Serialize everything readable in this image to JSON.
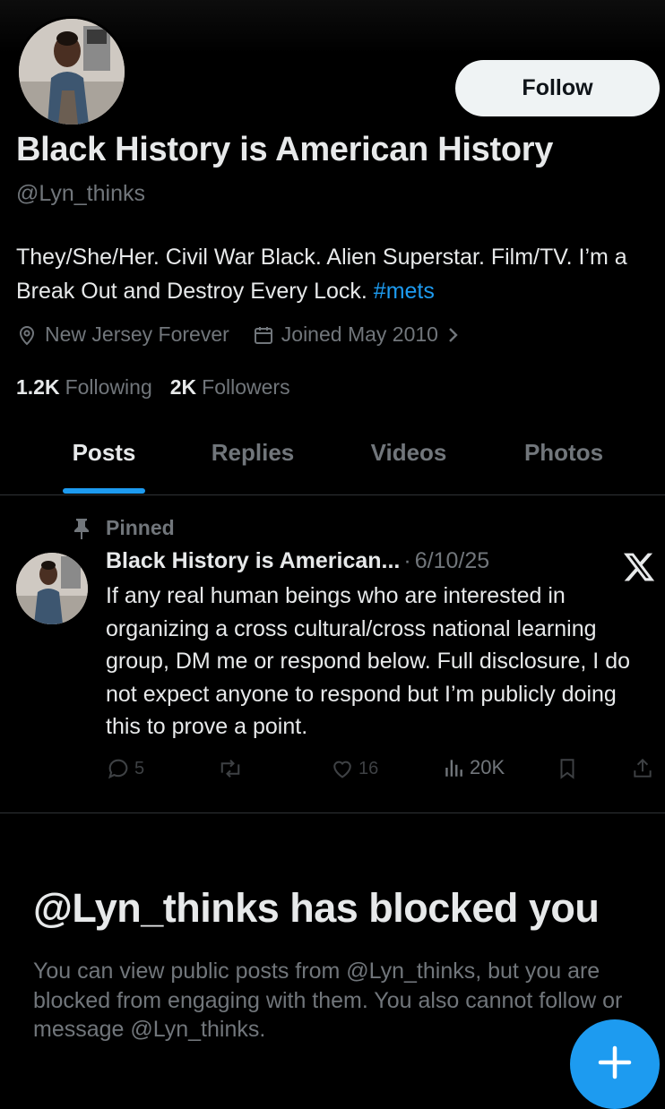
{
  "profile": {
    "display_name": "Black History is American History",
    "handle": "@Lyn_thinks",
    "bio_text": "They/She/Her. Civil War Black. Alien Superstar. Film/TV. I’m a Break Out and Destroy Every Lock.",
    "bio_hashtag": "#mets",
    "location": "New Jersey Forever",
    "joined": "Joined May 2010",
    "following_count": "1.2K",
    "following_label": "Following",
    "followers_count": "2K",
    "followers_label": "Followers",
    "follow_button_label": "Follow"
  },
  "tabs": [
    {
      "label": "Posts",
      "active": true
    },
    {
      "label": "Replies",
      "active": false
    },
    {
      "label": "Videos",
      "active": false
    },
    {
      "label": "Photos",
      "active": false
    }
  ],
  "pinned_post": {
    "pinned_label": "Pinned",
    "author": "Black History is American...",
    "separator": "·",
    "date": "6/10/25",
    "text": "If any real human beings who are interested in organizing a cross cultural/cross national learning group, DM me or respond below. Full disclosure, I do not expect anyone to respond but I’m publicly doing this to prove a point.",
    "replies": "5",
    "reposts": "",
    "likes": "16",
    "views": "20K"
  },
  "blocked": {
    "title": "@Lyn_thinks has blocked you",
    "description": "You can view public posts from @Lyn_thinks, but you are blocked from engaging with them. You also cannot follow or message @Lyn_thinks."
  },
  "colors": {
    "background": "#000000",
    "accent": "#1d9bf0",
    "text_primary": "#e7e9ea",
    "text_secondary": "#71767b",
    "action_muted": "#3e4144",
    "divider": "#2f3336"
  },
  "icons": {
    "location": "location-pin-icon",
    "calendar": "calendar-icon",
    "chevron": "chevron-right-icon",
    "pin": "pin-icon",
    "reply": "reply-icon",
    "repost": "repost-icon",
    "like": "heart-icon",
    "views": "views-icon",
    "bookmark": "bookmark-icon",
    "share": "share-icon",
    "brand": "x-logo-icon",
    "compose": "plus-icon"
  }
}
